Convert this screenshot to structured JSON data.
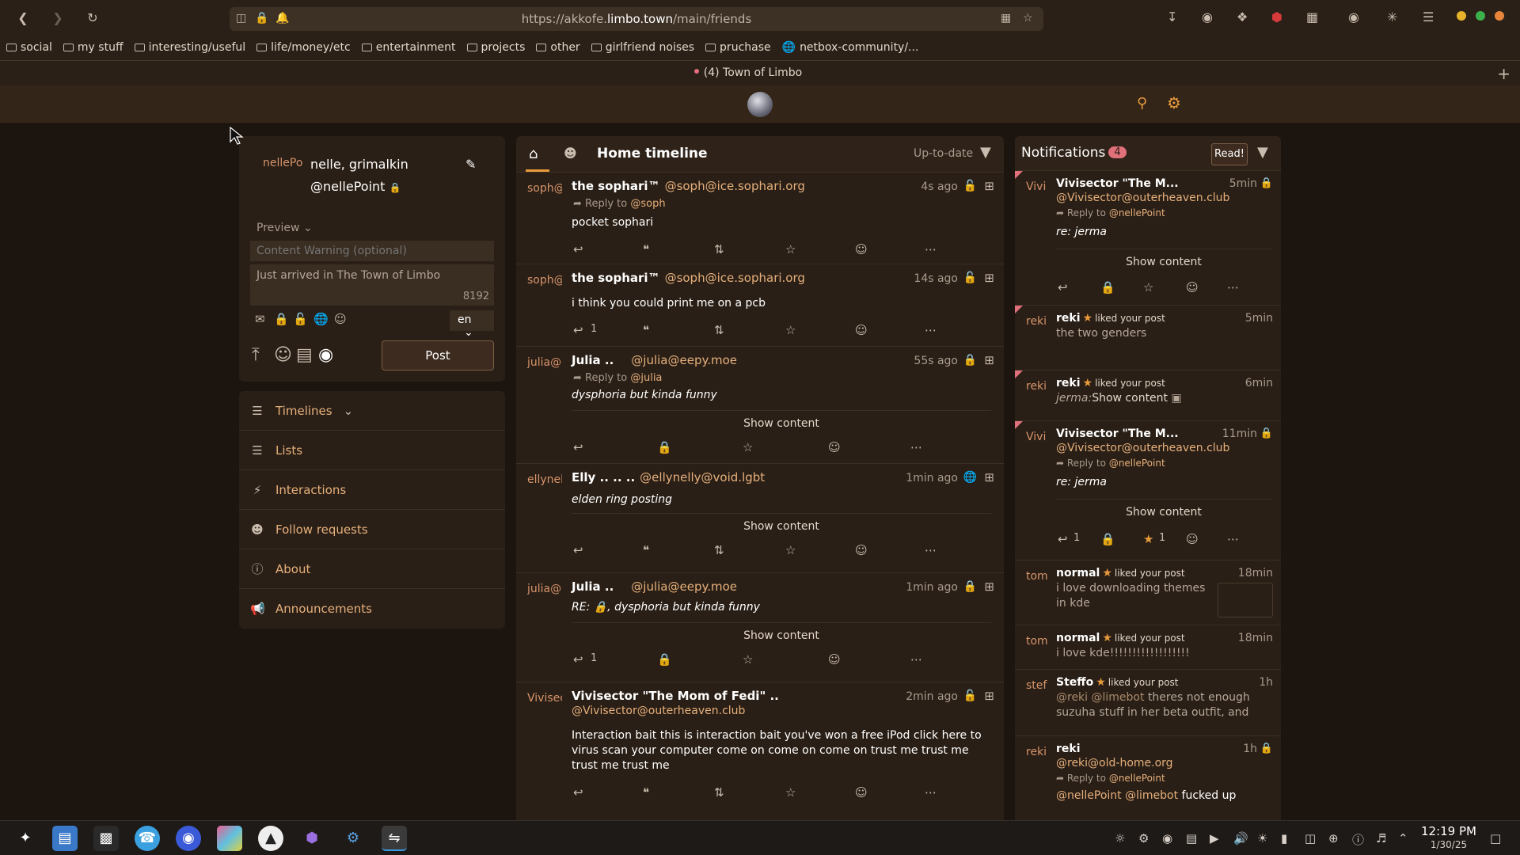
{
  "browser": {
    "url_prefix": "https://akkofe.",
    "url_host": "limbo.town",
    "url_path": "/main/friends",
    "bookmarks": [
      "social",
      "my stuff",
      "interesting/useful",
      "life/money/etc",
      "entertainment",
      "projects",
      "other",
      "girlfriend noises",
      "pruchase",
      "netbox-community/..."
    ],
    "tab_title": "(4) Town of Limbo"
  },
  "user": {
    "avatar_alt": "nellePo",
    "display_name": "nelle, grimalkin",
    "handle": "@nellePoint"
  },
  "composer": {
    "preview_label": "Preview",
    "cw_placeholder": "Content Warning (optional)",
    "status_placeholder": "Just arrived in The Town of Limbo",
    "char_count": "8192",
    "lang": "en",
    "post_label": "Post"
  },
  "nav": {
    "timelines": "Timelines",
    "lists": "Lists",
    "interactions": "Interactions",
    "follow_requests": "Follow requests",
    "about": "About",
    "announcements": "Announcements"
  },
  "timeline": {
    "title": "Home timeline",
    "status": "Up-to-date",
    "show_content": "Show content",
    "posts": [
      {
        "avatar": "soph@",
        "name": "the sophari™",
        "handle": "@soph@ice.sophari.org",
        "time": "4s ago",
        "reply_label": "Reply to",
        "reply_to": "@soph",
        "text": "pocket sophari",
        "reply_count": ""
      },
      {
        "avatar": "soph@",
        "name": "the sophari™",
        "handle": "@soph@ice.sophari.org",
        "time": "14s ago",
        "text": "i think you could print me on a pcb",
        "reply_count": "1"
      },
      {
        "avatar": "julia@",
        "name": "Julia ..",
        "handle": "@julia@eepy.moe",
        "time": "55s ago",
        "reply_label": "Reply to",
        "reply_to": "@julia",
        "text": "dysphoria but kinda funny"
      },
      {
        "avatar": "ellynel",
        "name": "Elly .. .. ..",
        "handle": "@ellynelly@void.lgbt",
        "time": "1min ago",
        "text": "elden ring posting"
      },
      {
        "avatar": "julia@",
        "name": "Julia ..",
        "handle": "@julia@eepy.moe",
        "time": "1min ago",
        "text": "RE: 🔒, dysphoria but kinda funny",
        "reply_count": "1"
      },
      {
        "avatar": "Vivisec",
        "name": "Vivisector \"The Mom of Fedi\" ..",
        "handle": "@Vivisector@outerheaven.club",
        "time": "2min ago",
        "text": "Interaction bait this is interaction bait you've won a free iPod click here to virus scan your computer come on come on come on trust me trust me trust me trust me"
      }
    ]
  },
  "notifications": {
    "title": "Notifications",
    "count": "4",
    "read_label": "Read!",
    "liked_label": "liked your post",
    "show_content": "Show content",
    "reply_label": "Reply to",
    "items": [
      {
        "avatar": "Vivi",
        "name": "Vivisector \"The M...",
        "handle": "@Vivisector@outerheaven.club",
        "time": "5min",
        "reply_to": "@nellePoint",
        "text": "re: jerma"
      },
      {
        "avatar": "reki",
        "name": "reki",
        "time": "5min",
        "text": "the two genders"
      },
      {
        "avatar": "reki",
        "name": "reki",
        "time": "6min",
        "text_cw": "jerma:",
        "text_show": "Show content"
      },
      {
        "avatar": "Vivi",
        "name": "Vivisector \"The M...",
        "handle": "@Vivisector@outerheaven.club",
        "time": "11min",
        "reply_to": "@nellePoint",
        "text": "re: jerma",
        "reply_count": "1",
        "fav_count": "1"
      },
      {
        "avatar": "tom",
        "name": "normal",
        "time": "18min",
        "text": "i love downloading themes in kde"
      },
      {
        "avatar": "tom",
        "name": "normal",
        "time": "18min",
        "text": "i love kde!!!!!!!!!!!!!!!!!!"
      },
      {
        "avatar": "stef",
        "name": "Steffo",
        "time": "1h",
        "mention": "@reki @limebot",
        "text": "theres not enough suzuha stuff in her beta outfit, and theres"
      },
      {
        "avatar": "reki",
        "name": "reki",
        "handle": "@reki@old-home.org",
        "time": "1h",
        "reply_to": "@nellePoint",
        "mention": "@nellePoint @limebot",
        "text": "fucked up"
      }
    ]
  },
  "taskbar": {
    "time": "12:19 PM",
    "date": "1/30/25"
  },
  "colors": {
    "accent": "#e89a3c",
    "link": "#e6b07c",
    "badge": "#e0707a",
    "panel": "#2a1f16",
    "background": "#1c140e"
  }
}
